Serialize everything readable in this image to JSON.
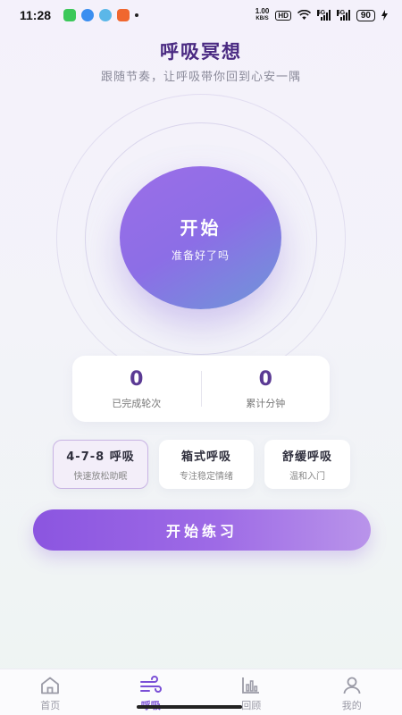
{
  "status_bar": {
    "time": "11:28",
    "net_speed_value": "1.00",
    "net_speed_unit": "KB/S",
    "hd_label": "HD",
    "sig1_label": "5G",
    "sig2_label": "5G",
    "battery": "90",
    "app_colors": [
      "#3cc85a",
      "#3a8ef0",
      "#5bb7e8",
      "#f0672f"
    ]
  },
  "header": {
    "title": "呼吸冥想",
    "subtitle": "跟随节奏，让呼吸带你回到心安一隅"
  },
  "orb": {
    "label": "开始",
    "sub_label": "准备好了吗"
  },
  "stats": [
    {
      "value": "0",
      "label": "已完成轮次"
    },
    {
      "value": "0",
      "label": "累计分钟"
    }
  ],
  "modes": [
    {
      "name": "4-7-8 呼吸",
      "desc": "快速放松助眠",
      "active": true
    },
    {
      "name": "箱式呼吸",
      "desc": "专注稳定情绪",
      "active": false
    },
    {
      "name": "舒缓呼吸",
      "desc": "温和入门",
      "active": false
    }
  ],
  "practice_button": {
    "label": "开始练习"
  },
  "tabs": [
    {
      "label": "首页",
      "icon": "home-icon"
    },
    {
      "label": "呼吸",
      "icon": "wind-icon",
      "active": true
    },
    {
      "label": "回顾",
      "icon": "chart-icon"
    },
    {
      "label": "我的",
      "icon": "user-icon"
    }
  ],
  "colors": {
    "accent": "#8b55e0",
    "title": "#4a2a82",
    "orb_start": "#9b6ee8",
    "orb_end": "#6e97d8"
  }
}
